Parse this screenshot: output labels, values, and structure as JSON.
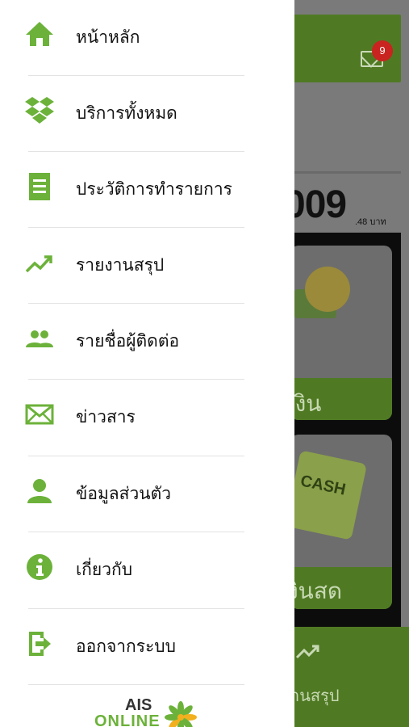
{
  "menu": {
    "items": [
      {
        "label": "หน้าหลัก",
        "icon": "home-icon"
      },
      {
        "label": "บริการทั้งหมด",
        "icon": "services-icon"
      },
      {
        "label": "ประวัติการทำรายการ",
        "icon": "receipt-icon"
      },
      {
        "label": "รายงานสรุป",
        "icon": "trending-up-icon"
      },
      {
        "label": "รายชื่อผู้ติดต่อ",
        "icon": "contacts-icon"
      },
      {
        "label": "ข่าวสาร",
        "icon": "mail-icon"
      },
      {
        "label": "ข้อมูลส่วนตัว",
        "icon": "person-icon"
      },
      {
        "label": "เกี่ยวกับ",
        "icon": "info-icon"
      },
      {
        "label": "ออกจากระบบ",
        "icon": "logout-icon"
      }
    ],
    "icon_color": "#6cb23a"
  },
  "logo": {
    "line1": "AIS",
    "line2": "ONLINE"
  },
  "background": {
    "notification_count": "9",
    "balance_partial": "009",
    "balance_suffix": ".48 บาท",
    "card1_label_partial": "เงิน",
    "card2_label_partial": "งินสด",
    "card2_art_text": "CASH",
    "bottom_label_partial": "านสรุป",
    "accent_color": "#4f7a23"
  }
}
